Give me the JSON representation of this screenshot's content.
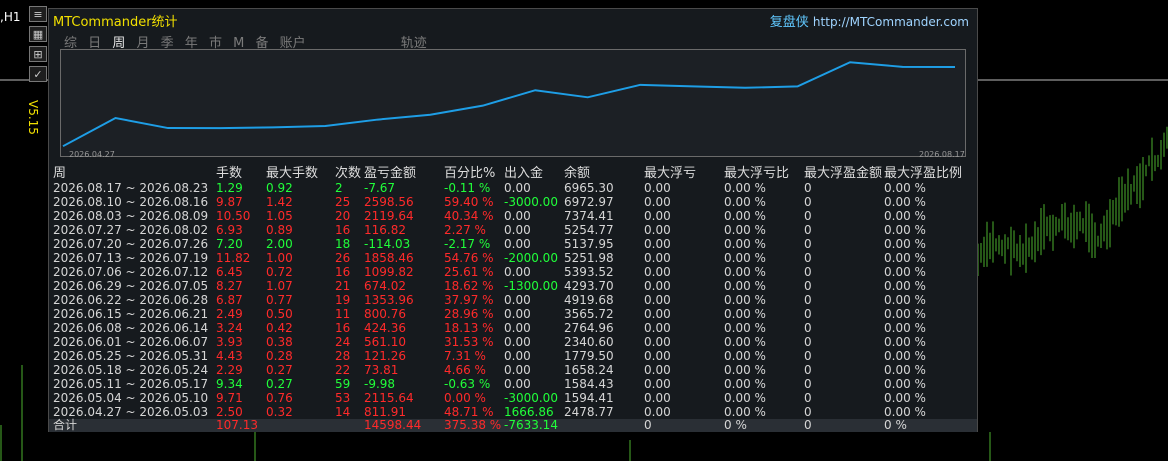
{
  "window": {
    "symbol_label": ",H1",
    "version": "V5.15"
  },
  "panel": {
    "title": "MTCommander统计",
    "brand": "复盘侠",
    "url": "http://MTCommander.com",
    "tabs": [
      "综",
      "日",
      "周",
      "月",
      "季",
      "年",
      "巿",
      "M",
      "备",
      "账户"
    ],
    "active_tab": "周",
    "track_tab": "轨迹"
  },
  "equity": {
    "start_date": "2026.04.27",
    "end_date": "2026.08.17",
    "balances": [
      2478.77,
      1594.41,
      1584.43,
      1658.24,
      1779.5,
      2340.6,
      2764.96,
      3565.72,
      4919.68,
      4293.7,
      5393.52,
      5251.98,
      5137.95,
      5254.77,
      7374.41,
      6972.97,
      6965.3
    ]
  },
  "table": {
    "headers": [
      "周",
      "手数",
      "最大手数",
      "次数",
      "盈亏金额",
      "百分比%",
      "出入金",
      "余额",
      "最大浮亏",
      "最大浮亏比",
      "最大浮盈金额",
      "最大浮盈比例"
    ],
    "rows": [
      [
        "2026.08.17 ~ 2026.08.23",
        "1.29",
        "0.92",
        "2",
        "-7.67",
        "-0.11 %",
        "0.00",
        "6965.30",
        "0.00",
        "0.00 %",
        "0",
        "0.00 %"
      ],
      [
        "2026.08.10 ~ 2026.08.16",
        "9.87",
        "1.42",
        "25",
        "2598.56",
        "59.40 %",
        "-3000.00",
        "6972.97",
        "0.00",
        "0.00 %",
        "0",
        "0.00 %"
      ],
      [
        "2026.08.03 ~ 2026.08.09",
        "10.50",
        "1.05",
        "20",
        "2119.64",
        "40.34 %",
        "0.00",
        "7374.41",
        "0.00",
        "0.00 %",
        "0",
        "0.00 %"
      ],
      [
        "2026.07.27 ~ 2026.08.02",
        "6.93",
        "0.89",
        "16",
        "116.82",
        "2.27 %",
        "0.00",
        "5254.77",
        "0.00",
        "0.00 %",
        "0",
        "0.00 %"
      ],
      [
        "2026.07.20 ~ 2026.07.26",
        "7.20",
        "2.00",
        "18",
        "-114.03",
        "-2.17 %",
        "0.00",
        "5137.95",
        "0.00",
        "0.00 %",
        "0",
        "0.00 %"
      ],
      [
        "2026.07.13 ~ 2026.07.19",
        "11.82",
        "1.00",
        "26",
        "1858.46",
        "54.76 %",
        "-2000.00",
        "5251.98",
        "0.00",
        "0.00 %",
        "0",
        "0.00 %"
      ],
      [
        "2026.07.06 ~ 2026.07.12",
        "6.45",
        "0.72",
        "16",
        "1099.82",
        "25.61 %",
        "0.00",
        "5393.52",
        "0.00",
        "0.00 %",
        "0",
        "0.00 %"
      ],
      [
        "2026.06.29 ~ 2026.07.05",
        "8.27",
        "1.07",
        "21",
        "674.02",
        "18.62 %",
        "-1300.00",
        "4293.70",
        "0.00",
        "0.00 %",
        "0",
        "0.00 %"
      ],
      [
        "2026.06.22 ~ 2026.06.28",
        "6.87",
        "0.77",
        "19",
        "1353.96",
        "37.97 %",
        "0.00",
        "4919.68",
        "0.00",
        "0.00 %",
        "0",
        "0.00 %"
      ],
      [
        "2026.06.15 ~ 2026.06.21",
        "2.49",
        "0.50",
        "11",
        "800.76",
        "28.96 %",
        "0.00",
        "3565.72",
        "0.00",
        "0.00 %",
        "0",
        "0.00 %"
      ],
      [
        "2026.06.08 ~ 2026.06.14",
        "3.24",
        "0.42",
        "16",
        "424.36",
        "18.13 %",
        "0.00",
        "2764.96",
        "0.00",
        "0.00 %",
        "0",
        "0.00 %"
      ],
      [
        "2026.06.01 ~ 2026.06.07",
        "3.93",
        "0.38",
        "24",
        "561.10",
        "31.53 %",
        "0.00",
        "2340.60",
        "0.00",
        "0.00 %",
        "0",
        "0.00 %"
      ],
      [
        "2026.05.25 ~ 2026.05.31",
        "4.43",
        "0.28",
        "28",
        "121.26",
        "7.31 %",
        "0.00",
        "1779.50",
        "0.00",
        "0.00 %",
        "0",
        "0.00 %"
      ],
      [
        "2026.05.18 ~ 2026.05.24",
        "2.29",
        "0.27",
        "22",
        "73.81",
        "4.66 %",
        "0.00",
        "1658.24",
        "0.00",
        "0.00 %",
        "0",
        "0.00 %"
      ],
      [
        "2026.05.11 ~ 2026.05.17",
        "9.34",
        "0.27",
        "59",
        "-9.98",
        "-0.63 %",
        "0.00",
        "1584.43",
        "0.00",
        "0.00 %",
        "0",
        "0.00 %"
      ],
      [
        "2026.05.04 ~ 2026.05.10",
        "9.71",
        "0.76",
        "53",
        "2115.64",
        "0.00 %",
        "-3000.00",
        "1594.41",
        "0.00",
        "0.00 %",
        "0",
        "0.00 %"
      ],
      [
        "2026.04.27 ~ 2026.05.03",
        "2.50",
        "0.32",
        "14",
        "811.91",
        "48.71 %",
        "1666.86",
        "2478.77",
        "0.00",
        "0.00 %",
        "0",
        "0.00 %"
      ]
    ],
    "totals": {
      "label": "合计",
      "lots": "107.13",
      "pnl": "14598.44",
      "pct": "375.38 %",
      "flow": "-7633.14",
      "maxfl": "0",
      "maxflpct": "0 %",
      "maxfp": "0",
      "maxfppct": "0 %"
    }
  },
  "colors": {
    "title": "#f2e000",
    "profit": "#ff2a2a",
    "loss": "#20ff3a",
    "equity_line": "#1e9ee6",
    "bg_candles": "#4caf2e"
  }
}
